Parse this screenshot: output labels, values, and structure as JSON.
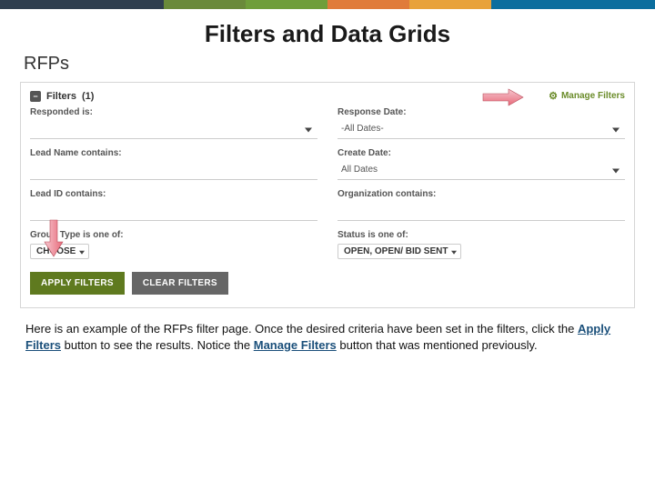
{
  "topbar_colors": [
    "#2f3e4e",
    "#2f3e4e",
    "#6a8a3a",
    "#6f9e3a",
    "#e07b3a",
    "#e8a23a",
    "#0b6e9e",
    "#0b6e9e"
  ],
  "slide": {
    "title": "Filters and Data Grids"
  },
  "page": {
    "heading": "RFPs"
  },
  "panel": {
    "title": "Filters",
    "count": "(1)",
    "manage_filters_label": "Manage Filters"
  },
  "filters": {
    "left": [
      {
        "label": "Responded is:",
        "type": "dropdown",
        "value": ""
      },
      {
        "label": "Lead Name contains:",
        "type": "text",
        "value": ""
      },
      {
        "label": "Lead ID contains:",
        "type": "text",
        "value": ""
      }
    ],
    "right": [
      {
        "label": "Response Date:",
        "type": "dropdown",
        "value": "-All Dates-"
      },
      {
        "label": "Create Date:",
        "type": "dropdown",
        "value": "All Dates"
      },
      {
        "label": "Organization contains:",
        "type": "text",
        "value": ""
      }
    ],
    "group_type": {
      "label": "Group Type is one of:",
      "tag": "CHOOSE"
    },
    "status": {
      "label": "Status is one of:",
      "tag": "OPEN, OPEN/ BID SENT"
    }
  },
  "buttons": {
    "apply": "APPLY FILTERS",
    "clear": "CLEAR FILTERS"
  },
  "caption": {
    "pre": "Here is an example of the RFPs filter page. Once the desired  criteria have been set in the filters, click the ",
    "link1": "Apply Filters",
    "mid": " button to see the results.  Notice the ",
    "link2": "Manage Filters",
    "post": " button that was mentioned previously."
  }
}
